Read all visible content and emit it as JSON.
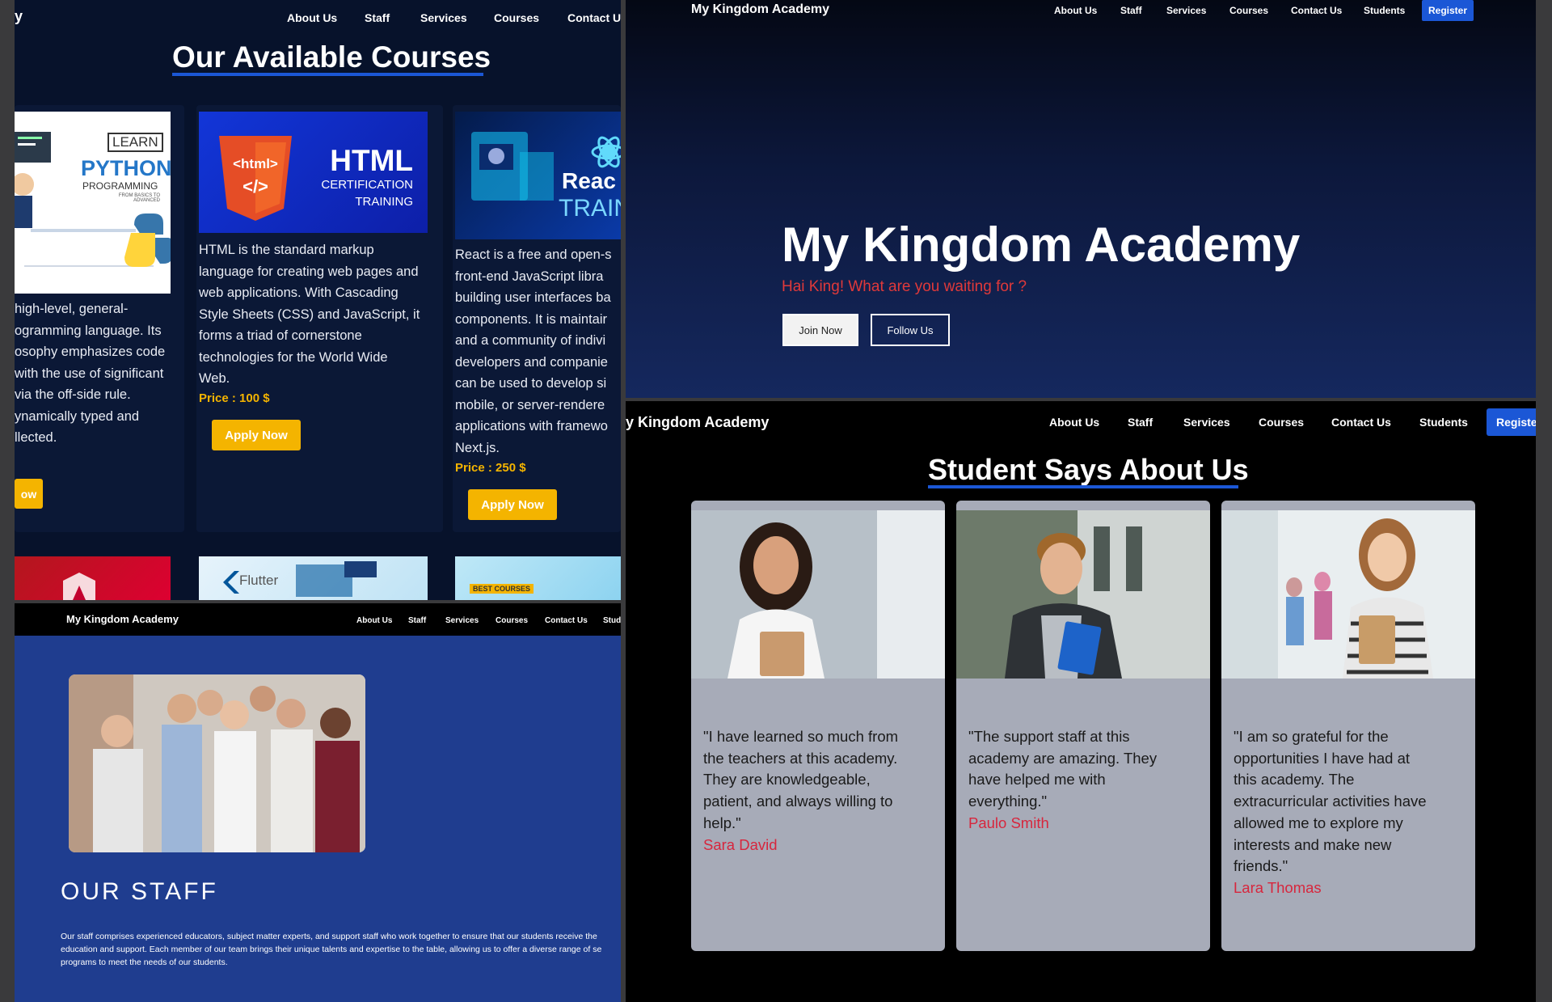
{
  "nav": {
    "brand": "My Kingdom Academy",
    "about": "About Us",
    "staff": "Staff",
    "services": "Services",
    "courses": "Courses",
    "contact": "Contact Us",
    "students": "Students",
    "register": "Register"
  },
  "courses_panel": {
    "brand_fragment": "y",
    "heading": "Our Available Courses",
    "apply_label": "Apply Now",
    "apply_fragment": "ow",
    "python": {
      "image_learn": "LEARN",
      "image_title": "PYTHON",
      "image_sub": "PROGRAMMING",
      "image_small": "FROM BASICS TO ADVANCED",
      "lines": [
        "high-level, general-",
        "ogramming language. Its",
        "osophy emphasizes code",
        "with the use of significant",
        "via the off-side rule.",
        "ynamically typed and",
        "llected."
      ]
    },
    "html": {
      "image_tag1": "<html>",
      "image_tag2": "</>",
      "image_title": "HTML",
      "image_sub1": "CERTIFICATION",
      "image_sub2": "TRAINING",
      "lines": [
        "HTML is the standard markup",
        "language for creating web pages and",
        "web applications. With Cascading",
        "Style Sheets (CSS) and JavaScript, it",
        "forms a triad of cornerstone",
        "technologies for the World Wide",
        "Web."
      ],
      "price": "Price : 100 $"
    },
    "react": {
      "image_title": "Reac",
      "image_sub": "TRAIN",
      "lines": [
        "React is a free and open-s",
        "front-end JavaScript libra",
        "building user interfaces ba",
        "components. It is maintair",
        "and a community of indivi",
        "developers and companie",
        "can be used to develop si",
        "mobile, or server-rendere",
        "applications with framewo",
        "Next.js."
      ],
      "price": "Price : 250 $"
    },
    "flutter_label": "Flutter",
    "best_courses": "BEST COURSES"
  },
  "hero": {
    "title": "My Kingdom Academy",
    "subtitle": "Hai King! What are you waiting for ?",
    "join": "Join Now",
    "follow": "Follow Us"
  },
  "testimonials": {
    "brand": "y Kingdom Academy",
    "register_fragment": "Registe",
    "heading": "Student Says About Us",
    "items": [
      {
        "lines": [
          "\"I have learned so much from",
          "the teachers at this academy.",
          "They are knowledgeable,",
          "patient, and always willing to",
          "help.\""
        ],
        "name": "Sara David"
      },
      {
        "lines": [
          "\"The support staff at this",
          "academy are amazing. They",
          "have helped me with",
          "everything.\""
        ],
        "name": "Paulo Smith"
      },
      {
        "lines": [
          "\"I am so grateful for the",
          "opportunities I have had at",
          "this academy. The",
          "extracurricular activities have",
          "allowed me to explore my",
          "interests and make new",
          "friends.\""
        ],
        "name": "Lara Thomas"
      }
    ]
  },
  "staff_panel": {
    "students_fragment": "Stud",
    "title": "OUR STAFF",
    "text_lines": [
      "Our staff comprises experienced educators, subject matter experts, and support staff who work together to ensure that our students receive the",
      "education and support. Each member of our team brings their unique talents and expertise to the table, allowing us to offer a diverse range of se",
      "programs to meet the needs of our students."
    ]
  },
  "colors": {
    "accent_blue": "#1b57d6",
    "apply_yellow": "#f4b400",
    "name_red": "#d7263d",
    "hero_red": "#e0393a"
  }
}
